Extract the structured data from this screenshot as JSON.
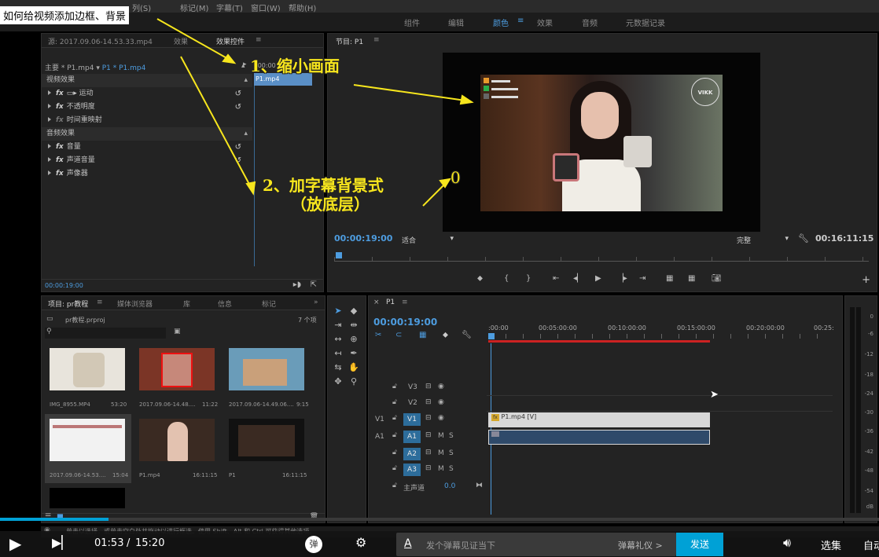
{
  "caption": "如何给视频添加边框、背景",
  "menu": [
    "列(S)",
    "标记(M)",
    "字幕(T)",
    "窗口(W)",
    "帮助(H)"
  ],
  "workspaces": [
    "组件",
    "编辑",
    "颜色",
    "效果",
    "音频",
    "元数据记录"
  ],
  "workspace_active": "颜色",
  "source_panel": {
    "tab_source": "源: 2017.09.06-14.53.33.mp4",
    "tab_effects": "效果",
    "tab_effect_controls": "效果控件",
    "master_label": "主要 * P1.mp4",
    "sequence_label": "P1 * P1.mp4",
    "clip_ruler": ":00:00",
    "clip_name": "P1.mp4",
    "video_header": "视频效果",
    "rows_video": [
      "运动",
      "不透明度",
      "时间重映射"
    ],
    "audio_header": "音频效果",
    "rows_audio": [
      "音量",
      "声道音量",
      "声像器"
    ],
    "timecode": "00:00:19:00"
  },
  "program": {
    "title": "节目: P1",
    "timecode_left": "00:00:19:00",
    "fit": "适合",
    "quality": "完整",
    "timecode_right": "00:16:11:15",
    "watermark": "VIKK"
  },
  "annotations": {
    "step1": "1、缩小画面",
    "step2": "2、加字幕背景式",
    "step2b": "（放底层）",
    "zero": "0"
  },
  "project": {
    "tabs": [
      "项目: pr教程",
      "媒体浏览器",
      "库",
      "信息",
      "标记"
    ],
    "file": "pr教程.prproj",
    "count": "7 个项",
    "items": [
      {
        "name": "IMG_8955.MP4",
        "dur": "53:20",
        "color": "#e8e4dc"
      },
      {
        "name": "2017.09.06-14.48....",
        "dur": "11:22",
        "color": "#8a3a2a"
      },
      {
        "name": "2017.09.06-14.49.06....",
        "dur": "9:15",
        "color": "#c9a07a"
      },
      {
        "name": "2017.09.06-14.53....",
        "dur": "15:04",
        "color": "#f2f2f2"
      },
      {
        "name": "P1.mp4",
        "dur": "16:11:15",
        "color": "#3a2a22"
      },
      {
        "name": "P1",
        "dur": "16:11:15",
        "color": "#111"
      }
    ]
  },
  "timeline": {
    "tab": "P1",
    "timecode": "00:00:19:00",
    "ruler": [
      ":00:00",
      "00:05:00:00",
      "00:10:00:00",
      "00:15:00:00",
      "00:20:00:00",
      "00:25:"
    ],
    "tracks_video": [
      "V3",
      "V2",
      "V1"
    ],
    "tracks_audio": [
      "A1",
      "A2",
      "A3"
    ],
    "v1_source": "V1",
    "a1_source": "A1",
    "master": "主声道",
    "master_val": "0.0",
    "clip_video": "P1.mp4 [V]"
  },
  "meter": [
    "0",
    "-6",
    "-12",
    "-18",
    "-24",
    "-30",
    "-36",
    "-42",
    "-48",
    "-54",
    "dB"
  ],
  "status": "单击以选择，或单击空白处并拖动以进行框选。使用 Shift、Alt 和 Ctrl 可获得其他选项。",
  "player": {
    "current": "01:53",
    "sep": "/",
    "total": "15:20",
    "danmu_placeholder": "发个弹幕见证当下",
    "danmu_etiquette": "弹幕礼仪 >",
    "send": "发送",
    "select": "选集",
    "auto": "自动",
    "danmu_badge": "弹",
    "progress": 0.123
  }
}
